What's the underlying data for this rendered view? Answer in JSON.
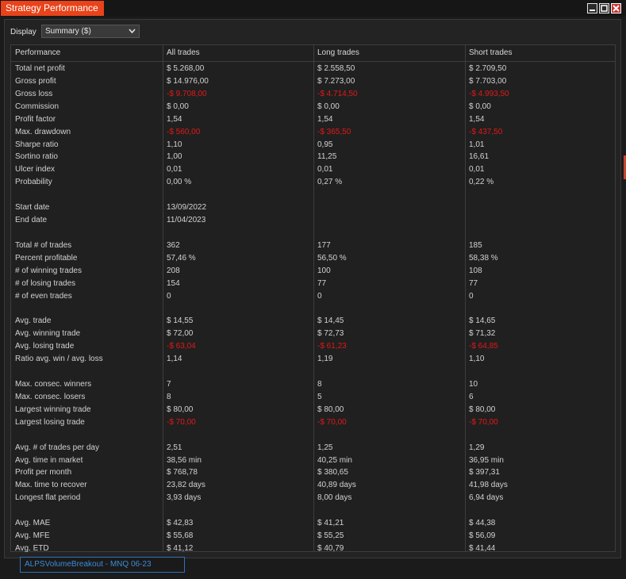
{
  "window": {
    "title": "Strategy Performance"
  },
  "display": {
    "label": "Display",
    "selected": "Summary ($)"
  },
  "columns": [
    "Performance",
    "All trades",
    "Long trades",
    "Short trades"
  ],
  "rows": [
    [
      "Total net profit",
      "$ 5.268,00",
      "$ 2.558,50",
      "$ 2.709,50"
    ],
    [
      "Gross profit",
      "$ 14.976,00",
      "$ 7.273,00",
      "$ 7.703,00"
    ],
    [
      "Gross loss",
      "-$ 9.708,00",
      "-$ 4.714,50",
      "-$ 4.993,50"
    ],
    [
      "Commission",
      "$ 0,00",
      "$ 0,00",
      "$ 0,00"
    ],
    [
      "Profit factor",
      "1,54",
      "1,54",
      "1,54"
    ],
    [
      "Max. drawdown",
      "-$ 560,00",
      "-$ 365,50",
      "-$ 437,50"
    ],
    [
      "Sharpe ratio",
      "1,10",
      "0,95",
      "1,01"
    ],
    [
      "Sortino ratio",
      "1,00",
      "11,25",
      "16,61"
    ],
    [
      "Ulcer index",
      "0,01",
      "0,01",
      "0,01"
    ],
    [
      "Probability",
      "0,00 %",
      "0,27 %",
      "0,22 %"
    ],
    [
      "",
      "",
      "",
      ""
    ],
    [
      "Start date",
      "13/09/2022",
      "",
      ""
    ],
    [
      "End date",
      "11/04/2023",
      "",
      ""
    ],
    [
      "",
      "",
      "",
      ""
    ],
    [
      "Total # of trades",
      "362",
      "177",
      "185"
    ],
    [
      "Percent profitable",
      "57,46 %",
      "56,50 %",
      "58,38 %"
    ],
    [
      "# of winning trades",
      "208",
      "100",
      "108"
    ],
    [
      "# of losing trades",
      "154",
      "77",
      "77"
    ],
    [
      "# of even trades",
      "0",
      "0",
      "0"
    ],
    [
      "",
      "",
      "",
      ""
    ],
    [
      "Avg. trade",
      "$ 14,55",
      "$ 14,45",
      "$ 14,65"
    ],
    [
      "Avg. winning trade",
      "$ 72,00",
      "$ 72,73",
      "$ 71,32"
    ],
    [
      "Avg. losing trade",
      "-$ 63,04",
      "-$ 61,23",
      "-$ 64,85"
    ],
    [
      "Ratio avg. win / avg. loss",
      "1,14",
      "1,19",
      "1,10"
    ],
    [
      "",
      "",
      "",
      ""
    ],
    [
      "Max. consec. winners",
      "7",
      "8",
      "10"
    ],
    [
      "Max. consec. losers",
      "8",
      "5",
      "6"
    ],
    [
      "Largest winning trade",
      "$ 80,00",
      "$ 80,00",
      "$ 80,00"
    ],
    [
      "Largest losing trade",
      "-$ 70,00",
      "-$ 70,00",
      "-$ 70,00"
    ],
    [
      "",
      "",
      "",
      ""
    ],
    [
      "Avg. # of trades per day",
      "2,51",
      "1,25",
      "1,29"
    ],
    [
      "Avg. time in market",
      "38,56 min",
      "40,25 min",
      "36,95 min"
    ],
    [
      "Profit per month",
      "$ 768,78",
      "$ 380,65",
      "$ 397,31"
    ],
    [
      "Max. time to recover",
      "23,82 days",
      "40,89 days",
      "41,98 days"
    ],
    [
      "Longest flat period",
      "3,93 days",
      "8,00 days",
      "6,94 days"
    ],
    [
      "",
      "",
      "",
      ""
    ],
    [
      "Avg. MAE",
      "$ 42,83",
      "$ 41,21",
      "$ 44,38"
    ],
    [
      "Avg. MFE",
      "$ 55,68",
      "$ 55,25",
      "$ 56,09"
    ],
    [
      "Avg. ETD",
      "$ 41,12",
      "$ 40,79",
      "$ 41,44"
    ]
  ],
  "strategy_tab": {
    "label": "ALPSVolumeBreakout - MNQ 06-23"
  },
  "colors": {
    "accent": "#e8431a",
    "negative": "#e21818",
    "tab_border": "#2d73b8"
  }
}
